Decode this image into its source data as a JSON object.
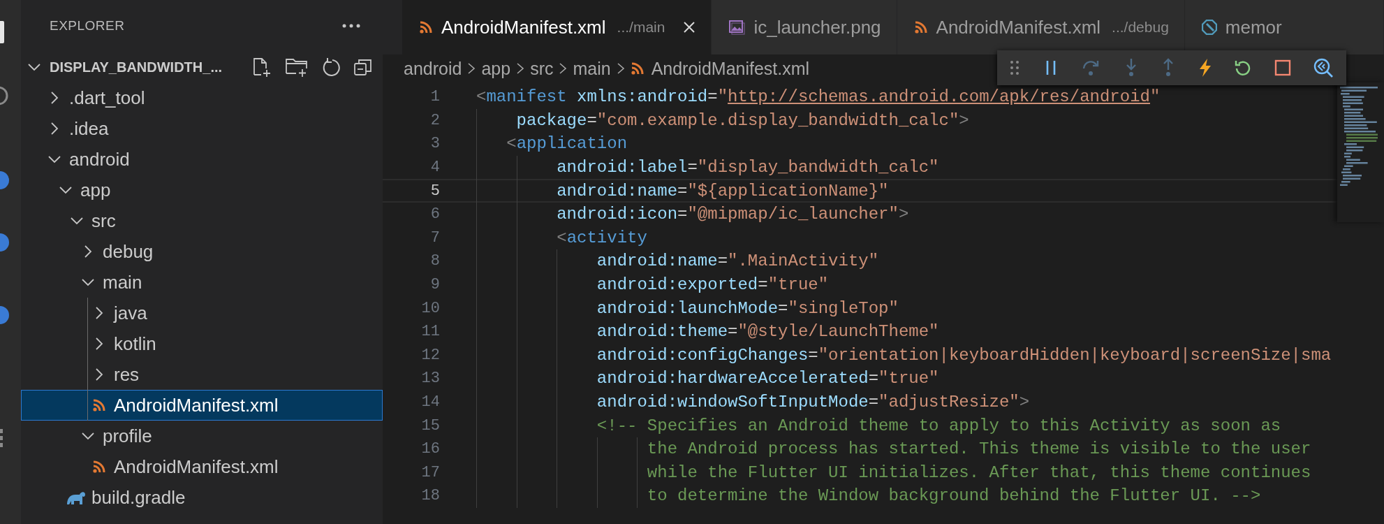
{
  "explorer": {
    "title": "EXPLORER",
    "root": {
      "label": "DISPLAY_BANDWIDTH_...",
      "expanded": true
    },
    "tree": [
      {
        "label": ".dart_tool",
        "kind": "folder",
        "expanded": false,
        "selected": false
      },
      {
        "label": ".idea",
        "kind": "folder",
        "expanded": false,
        "selected": false
      },
      {
        "label": "android",
        "kind": "folder",
        "expanded": true,
        "selected": false,
        "children": [
          {
            "label": "app",
            "kind": "folder",
            "expanded": true,
            "selected": false,
            "children": [
              {
                "label": "src",
                "kind": "folder",
                "expanded": true,
                "selected": false,
                "children": [
                  {
                    "label": "debug",
                    "kind": "folder",
                    "expanded": false,
                    "selected": false
                  },
                  {
                    "label": "main",
                    "kind": "folder",
                    "expanded": true,
                    "selected": false,
                    "children": [
                      {
                        "label": "java",
                        "kind": "folder",
                        "expanded": false,
                        "selected": false
                      },
                      {
                        "label": "kotlin",
                        "kind": "folder",
                        "expanded": false,
                        "selected": false
                      },
                      {
                        "label": "res",
                        "kind": "folder",
                        "expanded": false,
                        "selected": false
                      },
                      {
                        "label": "AndroidManifest.xml",
                        "kind": "xml",
                        "selected": true
                      }
                    ]
                  },
                  {
                    "label": "profile",
                    "kind": "folder",
                    "expanded": true,
                    "selected": false,
                    "children": [
                      {
                        "label": "AndroidManifest.xml",
                        "kind": "xml",
                        "selected": false
                      }
                    ]
                  }
                ]
              },
              {
                "label": "build.gradle",
                "kind": "gradle",
                "selected": false
              }
            ]
          }
        ]
      }
    ]
  },
  "tabs": [
    {
      "label": "AndroidManifest.xml",
      "description": ".../main",
      "kind": "xml",
      "selected": true
    },
    {
      "label": "ic_launcher.png",
      "kind": "image",
      "selected": false
    },
    {
      "label": "AndroidManifest.xml",
      "description": ".../debug",
      "kind": "xml",
      "selected": false
    },
    {
      "label": "memor",
      "kind": "dart",
      "selected": false
    }
  ],
  "breadcrumb": [
    {
      "label": "android",
      "kind": "folder"
    },
    {
      "label": "app",
      "kind": "folder"
    },
    {
      "label": "src",
      "kind": "folder"
    },
    {
      "label": "main",
      "kind": "folder"
    },
    {
      "label": "AndroidManifest.xml",
      "kind": "xml"
    }
  ],
  "debug_toolbar": [
    {
      "kind": "pause",
      "disabled": false
    },
    {
      "kind": "step-over",
      "disabled": true
    },
    {
      "kind": "step-into",
      "disabled": true
    },
    {
      "kind": "step-out",
      "disabled": true
    },
    {
      "kind": "hot-reload",
      "disabled": false
    },
    {
      "kind": "restart",
      "disabled": false
    },
    {
      "kind": "stop",
      "disabled": false
    },
    {
      "kind": "inspector",
      "disabled": false
    }
  ],
  "editor": {
    "lines": [
      {
        "number": "1",
        "current": false,
        "tokens": [
          {
            "t": "<",
            "kind": "punct"
          },
          {
            "t": "manifest",
            "kind": "tag"
          },
          {
            "t": " xmlns:android",
            "kind": "attr"
          },
          {
            "t": "=",
            "kind": "eq"
          },
          {
            "t": "\"",
            "kind": "str"
          },
          {
            "t": "http://schemas.android.com/apk/res/android",
            "kind": "link"
          },
          {
            "t": "\"",
            "kind": "str"
          }
        ]
      },
      {
        "number": "2",
        "current": false,
        "tokens": [
          {
            "t": "    package",
            "kind": "attr"
          },
          {
            "t": "=",
            "kind": "eq"
          },
          {
            "t": "\"com.example.display_bandwidth_calc\"",
            "kind": "str"
          },
          {
            "t": ">",
            "kind": "punct"
          }
        ]
      },
      {
        "number": "3",
        "current": false,
        "tokens": [
          {
            "t": "   <",
            "kind": "punct"
          },
          {
            "t": "application",
            "kind": "tag"
          }
        ]
      },
      {
        "number": "4",
        "current": false,
        "tokens": [
          {
            "t": "        android:label",
            "kind": "attr"
          },
          {
            "t": "=",
            "kind": "eq"
          },
          {
            "t": "\"display_bandwidth_calc\"",
            "kind": "str"
          }
        ]
      },
      {
        "number": "5",
        "current": true,
        "tokens": [
          {
            "t": "        android:name",
            "kind": "attr"
          },
          {
            "t": "=",
            "kind": "eq"
          },
          {
            "t": "\"${applicationName}\"",
            "kind": "str"
          }
        ]
      },
      {
        "number": "6",
        "current": false,
        "tokens": [
          {
            "t": "        android:icon",
            "kind": "attr"
          },
          {
            "t": "=",
            "kind": "eq"
          },
          {
            "t": "\"@mipmap/ic_launcher\"",
            "kind": "str"
          },
          {
            "t": ">",
            "kind": "punct"
          }
        ]
      },
      {
        "number": "7",
        "current": false,
        "tokens": [
          {
            "t": "        <",
            "kind": "punct"
          },
          {
            "t": "activity",
            "kind": "tag"
          }
        ]
      },
      {
        "number": "8",
        "current": false,
        "tokens": [
          {
            "t": "            android:name",
            "kind": "attr"
          },
          {
            "t": "=",
            "kind": "eq"
          },
          {
            "t": "\".MainActivity\"",
            "kind": "str"
          }
        ]
      },
      {
        "number": "9",
        "current": false,
        "tokens": [
          {
            "t": "            android:exported",
            "kind": "attr"
          },
          {
            "t": "=",
            "kind": "eq"
          },
          {
            "t": "\"true\"",
            "kind": "str"
          }
        ]
      },
      {
        "number": "10",
        "current": false,
        "tokens": [
          {
            "t": "            android:launchMode",
            "kind": "attr"
          },
          {
            "t": "=",
            "kind": "eq"
          },
          {
            "t": "\"singleTop\"",
            "kind": "str"
          }
        ]
      },
      {
        "number": "11",
        "current": false,
        "tokens": [
          {
            "t": "            android:theme",
            "kind": "attr"
          },
          {
            "t": "=",
            "kind": "eq"
          },
          {
            "t": "\"@style/LaunchTheme\"",
            "kind": "str"
          }
        ]
      },
      {
        "number": "12",
        "current": false,
        "tokens": [
          {
            "t": "            android:configChanges",
            "kind": "attr"
          },
          {
            "t": "=",
            "kind": "eq"
          },
          {
            "t": "\"orientation|keyboardHidden|keyboard|screenSize|sma",
            "kind": "str"
          }
        ]
      },
      {
        "number": "13",
        "current": false,
        "tokens": [
          {
            "t": "            android:hardwareAccelerated",
            "kind": "attr"
          },
          {
            "t": "=",
            "kind": "eq"
          },
          {
            "t": "\"true\"",
            "kind": "str"
          }
        ]
      },
      {
        "number": "14",
        "current": false,
        "tokens": [
          {
            "t": "            android:windowSoftInputMode",
            "kind": "attr"
          },
          {
            "t": "=",
            "kind": "eq"
          },
          {
            "t": "\"adjustResize\"",
            "kind": "str"
          },
          {
            "t": ">",
            "kind": "punct"
          }
        ]
      },
      {
        "number": "15",
        "current": false,
        "tokens": [
          {
            "t": "            <!-- Specifies an Android theme to apply to this Activity as soon as",
            "kind": "comment"
          }
        ]
      },
      {
        "number": "16",
        "current": false,
        "tokens": [
          {
            "t": "                 the Android process has started. This theme is visible to the user",
            "kind": "comment"
          }
        ]
      },
      {
        "number": "17",
        "current": false,
        "tokens": [
          {
            "t": "                 while the Flutter UI initializes. After that, this theme continues",
            "kind": "comment"
          }
        ]
      },
      {
        "number": "18",
        "current": false,
        "tokens": [
          {
            "t": "                 to determine the Window background behind the Flutter UI. -->",
            "kind": "comment"
          }
        ]
      }
    ]
  }
}
